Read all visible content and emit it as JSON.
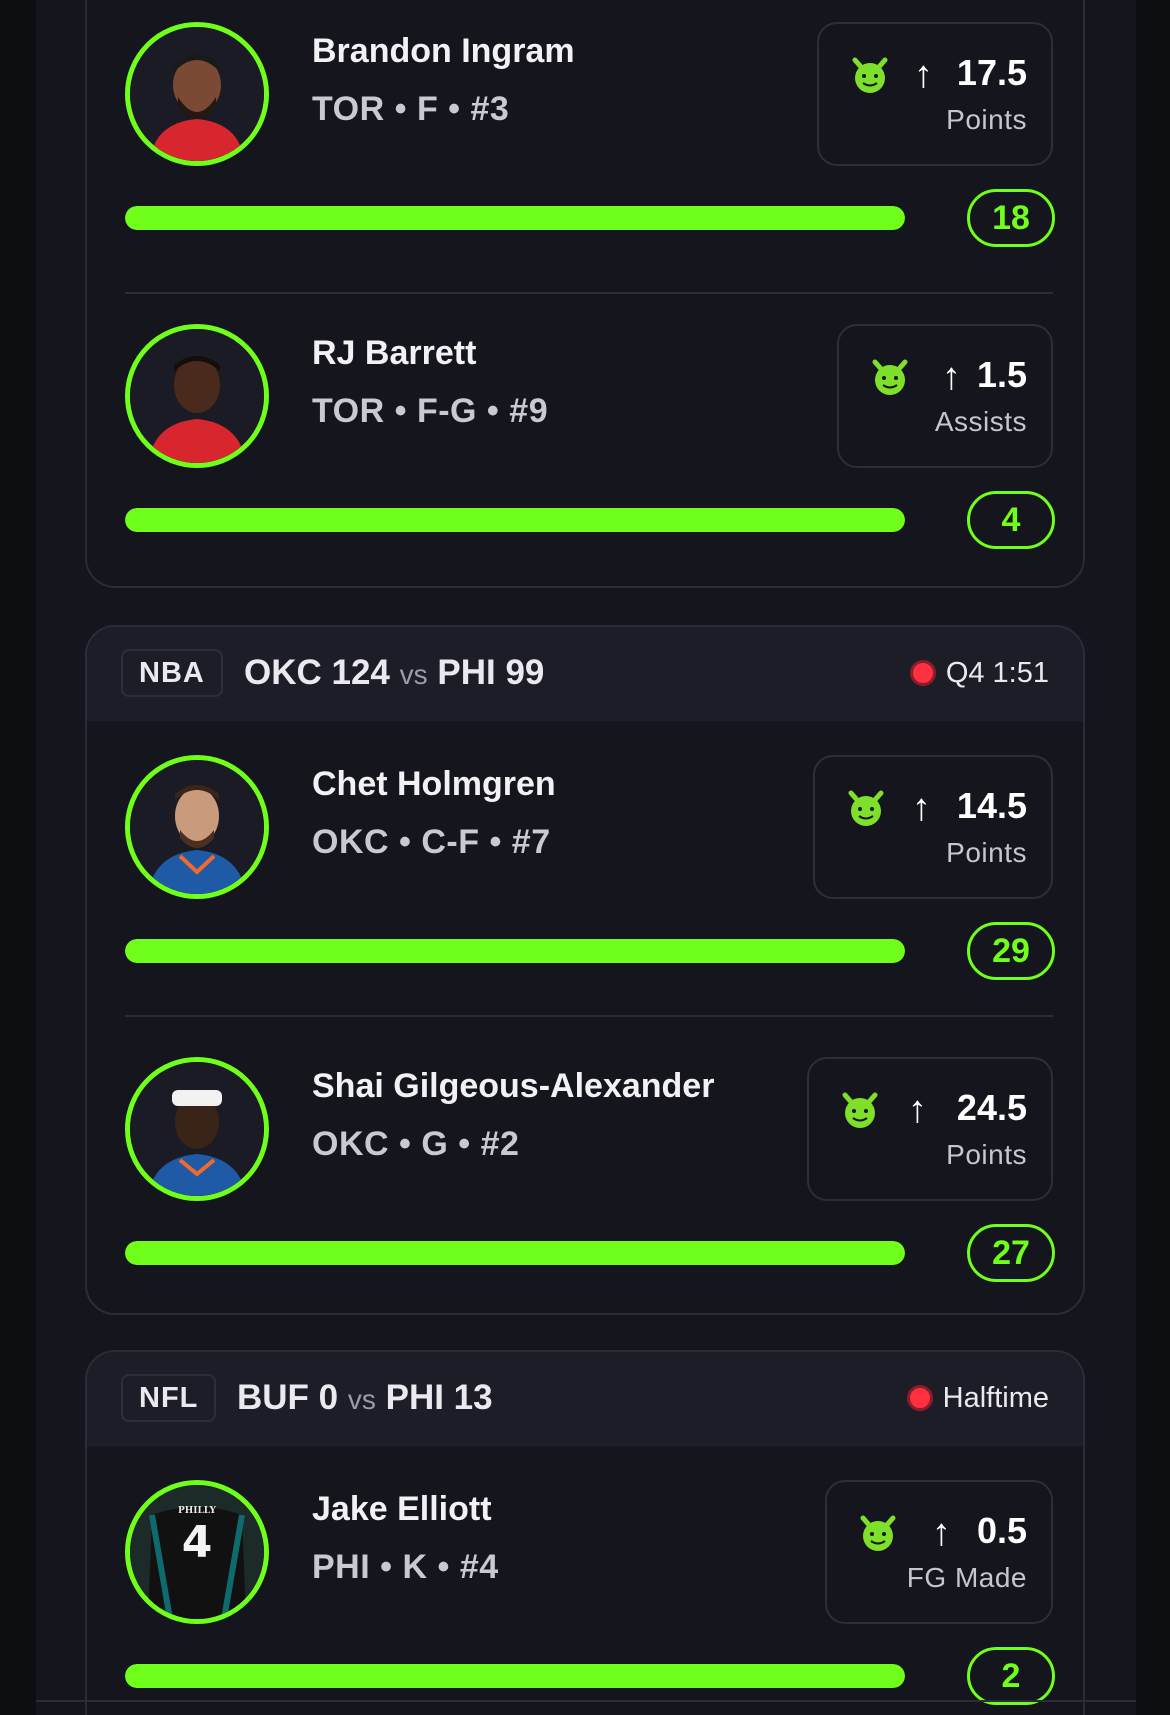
{
  "cards": [
    {
      "league": "",
      "players": [
        {
          "name": "Brandon Ingram",
          "meta": "TOR • F • #3",
          "line": "17.5",
          "stat": "Points",
          "actual": "18",
          "progress": 1.0
        },
        {
          "name": "RJ Barrett",
          "meta": "TOR • F-G • #9",
          "line": "1.5",
          "stat": "Assists",
          "actual": "4",
          "progress": 1.0
        }
      ]
    },
    {
      "league": "NBA",
      "team1": "OKC 124",
      "vs": "vs",
      "team2": "PHI 99",
      "status": "Q4 1:51",
      "players": [
        {
          "name": "Chet Holmgren",
          "meta": "OKC • C-F • #7",
          "line": "14.5",
          "stat": "Points",
          "actual": "29",
          "progress": 1.0
        },
        {
          "name": "Shai Gilgeous-Alexander",
          "meta": "OKC • G • #2",
          "line": "24.5",
          "stat": "Points",
          "actual": "27",
          "progress": 1.0
        }
      ]
    },
    {
      "league": "NFL",
      "team1": "BUF 0",
      "vs": "vs",
      "team2": "PHI 13",
      "status": "Halftime",
      "players": [
        {
          "name": "Jake Elliott",
          "meta": "PHI • K • #4",
          "line": "0.5",
          "stat": "FG Made",
          "actual": "2",
          "progress": 1.0,
          "jersey_number": "4",
          "jersey_text": "PHILLY"
        }
      ]
    }
  ],
  "icons": {
    "over_pick": "devil-icon",
    "direction": "arrow-up-icon",
    "live": "live-dot-icon"
  },
  "colors": {
    "accent": "#6fff1a",
    "live": "#ff3040",
    "background": "#14151d"
  },
  "arrow_glyph": "↑"
}
